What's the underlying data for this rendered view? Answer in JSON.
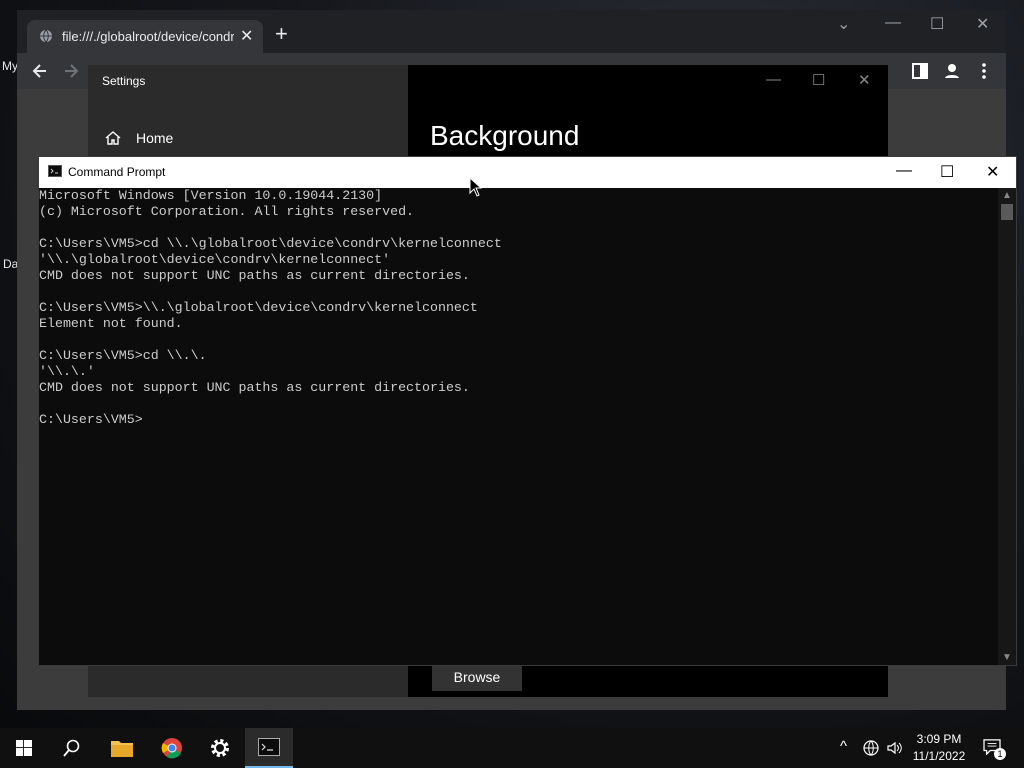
{
  "desktop": {
    "label_1": "My",
    "label_2": "Da"
  },
  "chrome": {
    "tab_title": "file:///./globalroot/device/condrv/",
    "tab_close": "✕",
    "new_tab": "+",
    "controls": {
      "dropdown": "⌄",
      "minimize": "—",
      "maximize": "☐",
      "close": "✕"
    }
  },
  "settings": {
    "title": "Settings",
    "home_label": "Home",
    "heading": "Background",
    "browse_label": "Browse",
    "controls": {
      "minimize": "—",
      "maximize": "☐",
      "close": "✕"
    }
  },
  "cmd": {
    "title": "Command Prompt",
    "controls": {
      "minimize": "—",
      "maximize": "☐",
      "close": "✕"
    },
    "lines": [
      "Microsoft Windows [Version 10.0.19044.2130]",
      "(c) Microsoft Corporation. All rights reserved.",
      "",
      "C:\\Users\\VM5>cd \\\\.\\globalroot\\device\\condrv\\kernelconnect",
      "'\\\\.\\globalroot\\device\\condrv\\kernelconnect'",
      "CMD does not support UNC paths as current directories.",
      "",
      "C:\\Users\\VM5>\\\\.\\globalroot\\device\\condrv\\kernelconnect",
      "Element not found.",
      "",
      "C:\\Users\\VM5>cd \\\\.\\.",
      "'\\\\.\\.'",
      "CMD does not support UNC paths as current directories.",
      "",
      "C:\\Users\\VM5>"
    ]
  },
  "taskbar": {
    "time": "3:09 PM",
    "date": "11/1/2022",
    "notification_count": "1",
    "tray_chevron": "^"
  },
  "colors": {
    "cmd_background": "#0c0c0c",
    "cmd_text": "#cccccc",
    "chrome_dark": "#202124",
    "taskbar": "#101010",
    "active_indicator": "#76b9ed"
  },
  "icons": {
    "start": "windows-logo-icon",
    "search": "search-icon",
    "explorer": "folder-icon",
    "chrome": "chrome-icon",
    "settings": "gear-icon",
    "cmd": "terminal-icon"
  }
}
